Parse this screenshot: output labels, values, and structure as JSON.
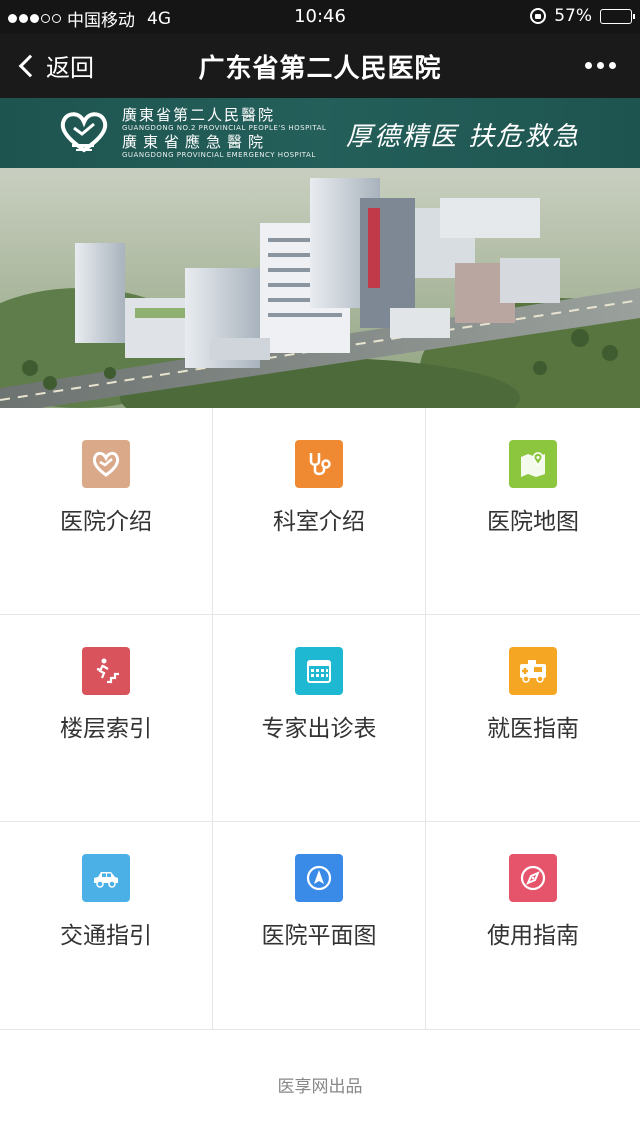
{
  "status_bar": {
    "carrier": "中国移动",
    "network": "4G",
    "time": "10:46",
    "battery": "57%",
    "battery_level": 0.57
  },
  "nav": {
    "back_label": "返回",
    "title": "广东省第二人民医院"
  },
  "banner": {
    "name_line1": "廣東省第二人民醫院",
    "name_en1": "GUANGDONG NO.2 PROVINCIAL PEOPLE'S HOSPITAL",
    "name_line2": "廣東省應急醫院",
    "name_en2": "GUANGDONG PROVINCIAL EMERGENCY HOSPITAL",
    "motto": "厚德精医 扶危救急"
  },
  "menu": [
    {
      "label": "医院介绍",
      "icon": "heart-logo-icon",
      "color": "#d9a98a"
    },
    {
      "label": "科室介绍",
      "icon": "stethoscope-icon",
      "color": "#f08a32"
    },
    {
      "label": "医院地图",
      "icon": "map-pin-icon",
      "color": "#8cc63e"
    },
    {
      "label": "楼层索引",
      "icon": "stairs-icon",
      "color": "#d9535c"
    },
    {
      "label": "专家出诊表",
      "icon": "calendar-icon",
      "color": "#1fb8d2"
    },
    {
      "label": "就医指南",
      "icon": "ambulance-icon",
      "color": "#f5a623"
    },
    {
      "label": "交通指引",
      "icon": "car-icon",
      "color": "#4ab0e6"
    },
    {
      "label": "医院平面图",
      "icon": "navigation-icon",
      "color": "#3a8be8"
    },
    {
      "label": "使用指南",
      "icon": "compass-icon",
      "color": "#e5546a"
    }
  ],
  "footer": {
    "text": "医享网出品"
  }
}
